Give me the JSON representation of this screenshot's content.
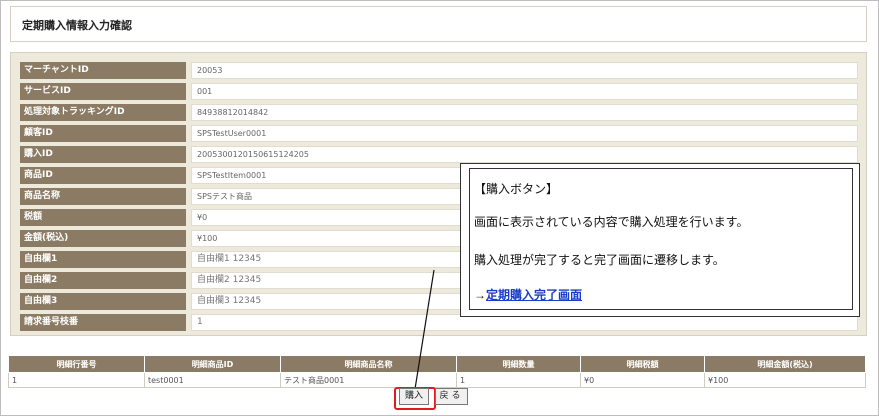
{
  "page": {
    "title": "定期購入情報入力確認"
  },
  "info_rows": [
    {
      "label": "マーチャントID",
      "value": "20053"
    },
    {
      "label": "サービスID",
      "value": "001"
    },
    {
      "label": "処理対象トラッキングID",
      "value": "84938812014842"
    },
    {
      "label": "顧客ID",
      "value": "SPSTestUser0001"
    },
    {
      "label": "購入ID",
      "value": "20053001201506151242​05"
    },
    {
      "label": "商品ID",
      "value": "SPSTestItem0001"
    },
    {
      "label": "商品名称",
      "value": "SPSテスト商品"
    },
    {
      "label": "税額",
      "value": "¥0"
    },
    {
      "label": "金額(税込)",
      "value": "¥100"
    },
    {
      "label": "自由欄1",
      "value": "自由欄1 12345"
    },
    {
      "label": "自由欄2",
      "value": "自由欄2 12345"
    },
    {
      "label": "自由欄3",
      "value": "自由欄3 12345"
    },
    {
      "label": "請求番号枝番",
      "value": "1"
    }
  ],
  "callout": {
    "heading": "【購入ボタン】",
    "line1": "画面に表示されている内容で購入処理を行います。",
    "line2": "購入処理が完了すると完了画面に遷移します。",
    "arrow": "→",
    "link": "定期購入完了画面"
  },
  "detail_table": {
    "headers": [
      "明細行番号",
      "明細商品ID",
      "明細商品名称",
      "明細数量",
      "明細税額",
      "明細金額(税込)"
    ],
    "rows": [
      [
        "1",
        "test0001",
        "テスト商品0001",
        "1",
        "¥0",
        "¥100"
      ]
    ]
  },
  "buttons": {
    "purchase": "購入",
    "back": "戻る"
  },
  "colors": {
    "label_bg": "#8b7b64",
    "panel_bg": "#eeeadb",
    "highlight": "#e01b1b",
    "link": "#1a3cc8"
  }
}
